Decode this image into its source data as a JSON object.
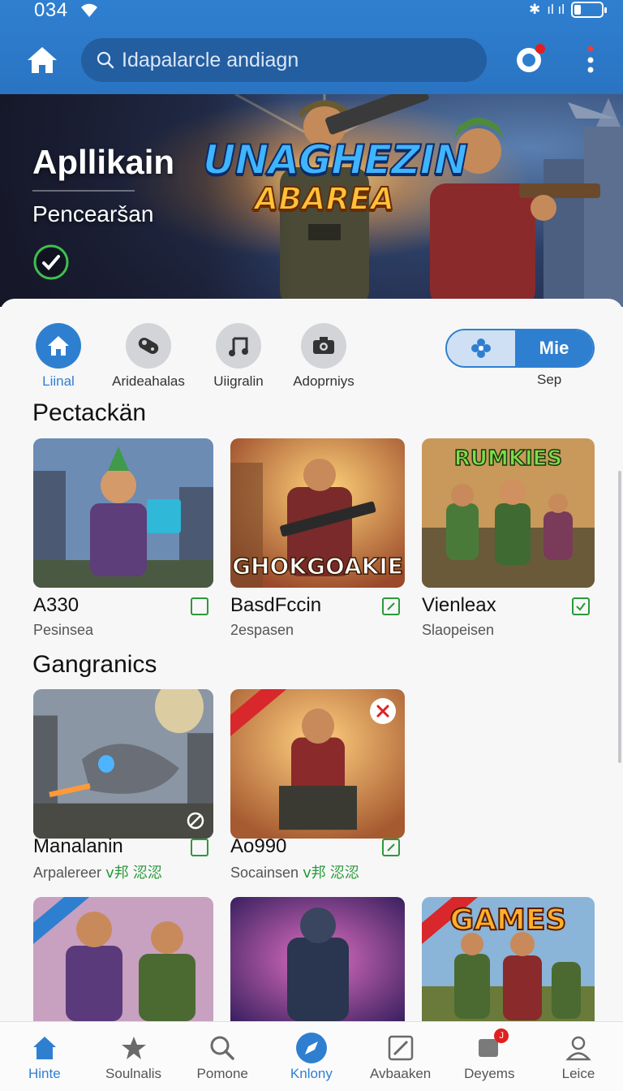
{
  "status": {
    "time": "034",
    "signal_text": "ıl ıl"
  },
  "search": {
    "placeholder": "Idapalarcle andiagn"
  },
  "hero": {
    "title": "Apllikain",
    "subtitle": "Pencearšan",
    "logo_line1": "UNAGHEZIN",
    "logo_line2": "ABAREA"
  },
  "categories": [
    {
      "label": "Liinal",
      "icon": "home-icon",
      "active": true
    },
    {
      "label": "Arideahalas",
      "icon": "gamepad-icon",
      "active": false
    },
    {
      "label": "Uiigralin",
      "icon": "music-note-icon",
      "active": false
    },
    {
      "label": "Adoprniys",
      "icon": "camera-icon",
      "active": false
    }
  ],
  "segment": {
    "left_icon": "flower-icon",
    "right_label": "Mie",
    "caption": "Sep"
  },
  "sections": [
    {
      "title": "Pectackän",
      "cards": [
        {
          "title": "A330",
          "subtitle": "Pesinsea",
          "checked": false,
          "thumb_text": ""
        },
        {
          "title": "BasdFccin",
          "subtitle": "2espasen",
          "checked": true,
          "thumb_text": "GHOKGOAKIE"
        },
        {
          "title": "Vienleax",
          "subtitle": "Slaopeisen",
          "checked": true,
          "thumb_text": "RUMKIES"
        }
      ]
    },
    {
      "title": "Gangranics",
      "cards": [
        {
          "title": "Manalanin",
          "subtitle": "Arpalereer",
          "rating": "ⅴ邦 涊涊",
          "checked": false
        },
        {
          "title": "Ao990",
          "subtitle": "Socainsen",
          "rating": "ⅴ邦 涊涊",
          "checked": true
        }
      ]
    },
    {
      "cards": [
        {
          "ribbon": "blue"
        },
        {},
        {
          "thumb_text": "GAMES",
          "ribbon": "red"
        }
      ]
    }
  ],
  "bottom_nav": [
    {
      "label": "Hinte",
      "icon": "home-icon"
    },
    {
      "label": "Soulnalis",
      "icon": "star-icon"
    },
    {
      "label": "Pomone",
      "icon": "search-icon"
    },
    {
      "label": "Knlony",
      "icon": "compass-icon"
    },
    {
      "label": "Avbaaken",
      "icon": "edit-icon"
    },
    {
      "label": "Deyems",
      "icon": "messages-icon",
      "badge": "J"
    },
    {
      "label": "Leice",
      "icon": "user-icon"
    }
  ],
  "colors": {
    "primary": "#2f7fd0",
    "check_green": "#2a9a3a",
    "badge_red": "#e02020"
  }
}
